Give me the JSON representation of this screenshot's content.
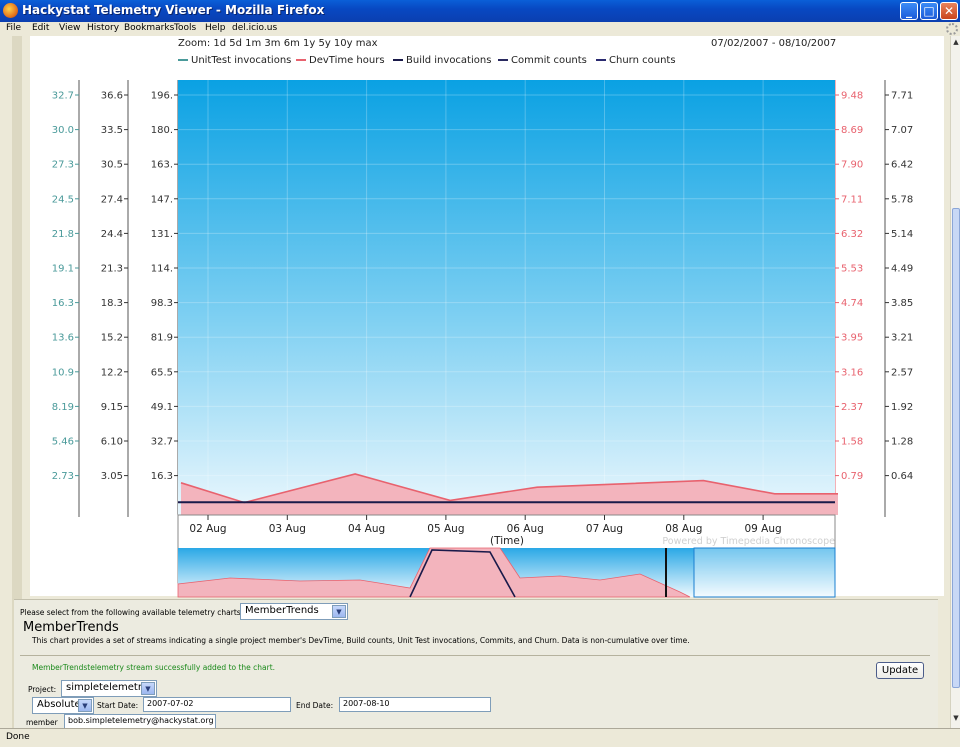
{
  "window": {
    "title": "Hackystat Telemetry Viewer - Mozilla Firefox",
    "controls": {
      "minimize": "_",
      "maximize": "□",
      "close": "✕"
    }
  },
  "menubar": {
    "items": [
      {
        "label": "File"
      },
      {
        "label": "Edit"
      },
      {
        "label": "View"
      },
      {
        "label": "History"
      },
      {
        "label": "Bookmarks"
      },
      {
        "label": "Tools"
      },
      {
        "label": "Help"
      },
      {
        "label": "del.icio.us"
      }
    ]
  },
  "chart_header": {
    "zoom": "Zoom: 1d 5d 1m 3m 6m 1y 5y 10y max",
    "date_range": "07/02/2007 - 08/10/2007"
  },
  "colors": {
    "unittest": "#4a9a9a",
    "devtime": "#e8626e",
    "build": "#1a1a4a",
    "commit": "#2a2a60",
    "churn": "#2a2a70",
    "sky_top": "#0aa1e3",
    "sky_bottom": "#e8f6fd",
    "devtime_fill": "#f3b4bd"
  },
  "chart_data": {
    "type": "area",
    "x": [
      "02 Aug",
      "03 Aug",
      "04 Aug",
      "05 Aug",
      "06 Aug",
      "07 Aug",
      "08 Aug",
      "09 Aug"
    ],
    "xlabel": "(Time)",
    "watermark": "Powered by Timepedia Chronoscope",
    "legend": [
      "UnitTest invocations",
      "DevTime hours",
      "Build invocations",
      "Commit counts",
      "Churn counts"
    ],
    "axes": {
      "unittest": [
        "32.7",
        "30.0",
        "27.3",
        "24.5",
        "21.8",
        "19.1",
        "16.3",
        "13.6",
        "10.9",
        "8.19",
        "5.46",
        "2.73"
      ],
      "axis2": [
        "36.6",
        "33.5",
        "30.5",
        "27.4",
        "24.4",
        "21.3",
        "18.3",
        "15.2",
        "12.2",
        "9.15",
        "6.10",
        "3.05"
      ],
      "axis3": [
        "196.",
        "180.",
        "163.",
        "147.",
        "131.",
        "114.",
        "98.3",
        "81.9",
        "65.5",
        "49.1",
        "32.7",
        "16.3"
      ],
      "devtime": [
        "9.48",
        "8.69",
        "7.90",
        "7.11",
        "6.32",
        "5.53",
        "4.74",
        "3.95",
        "3.16",
        "2.37",
        "1.58",
        "0.79"
      ],
      "axis5": [
        "7.71",
        "7.07",
        "6.42",
        "5.78",
        "5.14",
        "4.49",
        "3.85",
        "3.21",
        "2.57",
        "1.92",
        "1.28",
        "0.64"
      ]
    },
    "series": [
      {
        "name": "DevTime hours",
        "points": [
          [
            1.6,
            1.1
          ],
          [
            2.4,
            0.2
          ],
          [
            3.8,
            1.5
          ],
          [
            5.0,
            0.3
          ],
          [
            6.1,
            0.9
          ],
          [
            8.2,
            1.2
          ],
          [
            9.1,
            0.6
          ],
          [
            9.9,
            0.6
          ]
        ]
      },
      {
        "name": "Build invocations",
        "points": [
          [
            1.5,
            0.4
          ],
          [
            9.9,
            0.4
          ]
        ]
      }
    ]
  },
  "form": {
    "select_prompt": "Please select from the following available telemetry charts:",
    "chart_select": "MemberTrends",
    "chart_title": "MemberTrends",
    "chart_description": "This chart provides a set of streams indicating a single project member's DevTime, Build counts, Unit Test invocations, Commits, and Churn. Data is non-cumulative over time.",
    "success_msg": "MemberTrendstelemetry stream successfully added to the chart.",
    "update_label": "Update",
    "project_label": "Project:",
    "project_value": "simpletelemetry",
    "mode_value": "Absolute",
    "start_label": "Start Date:",
    "start_value": "2007-07-02",
    "end_label": "End Date:",
    "end_value": "2007-08-10",
    "member_label": "member",
    "member_value": "bob.simpletelemetry@hackystat.org"
  },
  "status": {
    "text": "Done"
  }
}
